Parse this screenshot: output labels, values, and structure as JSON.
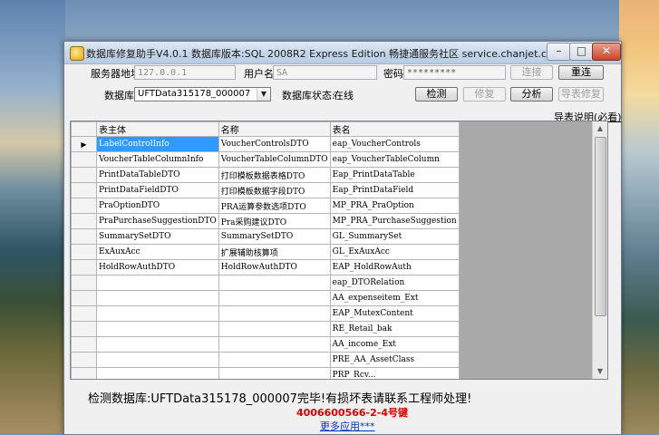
{
  "window": {
    "title": "数据库修复助手V4.0.1 数据库版本:SQL 2008R2 Express Edition  畅捷通服务社区 service.chanjet.com"
  },
  "form": {
    "server_label": "服务器地址",
    "server_value": "127.0.0.1",
    "user_label": "用户名",
    "user_value": "SA",
    "password_label": "密码",
    "password_value": "*********",
    "database_label": "数据库",
    "database_value": "UFTData315178_000007",
    "db_status_label": "数据库状态:",
    "db_status_value": "在线",
    "connect_btn": "连接",
    "reconnect_btn": "重连",
    "detect_btn": "检测",
    "repair_btn": "修复",
    "analyze_btn": "分析",
    "export_repair_btn": "导表修复",
    "export_notes_link": "导表说明(必看)"
  },
  "grid": {
    "columns": [
      "表主体",
      "名称",
      "表名"
    ],
    "rows": [
      [
        "LabelControlInfo",
        "VoucherControlsDTO",
        "eap_VoucherControls"
      ],
      [
        "VoucherTableColumnInfo",
        "VoucherTableColumnDTO",
        "eap_VoucherTableColumn"
      ],
      [
        "PrintDataTableDTO",
        "打印模板数据表格DTO",
        "Eap_PrintDataTable"
      ],
      [
        "PrintDataFieldDTO",
        "打印模板数据字段DTO",
        "Eap_PrintDataField"
      ],
      [
        "PraOptionDTO",
        "PRA运算参数选项DTO",
        "MP_PRA_PraOption"
      ],
      [
        "PraPurchaseSuggestionDTO",
        "Pra采购建议DTO",
        "MP_PRA_PurchaseSuggestion"
      ],
      [
        "SummarySetDTO",
        "SummarySetDTO",
        "GL_SummarySet"
      ],
      [
        "ExAuxAcc",
        "扩展辅助核算项",
        "GL_ExAuxAcc"
      ],
      [
        "HoldRowAuthDTO",
        "HoldRowAuthDTO",
        "EAP_HoldRowAuth"
      ],
      [
        "",
        "",
        "eap_DTORelation"
      ],
      [
        "",
        "",
        "AA_expenseitem_Ext"
      ],
      [
        "",
        "",
        "EAP_MutexContent"
      ],
      [
        "",
        "",
        "RE_Retail_bak"
      ],
      [
        "",
        "",
        "AA_income_Ext"
      ],
      [
        "",
        "",
        "PRE_AA_AssetClass"
      ],
      [
        "",
        "",
        "PRP_Rcv..."
      ]
    ]
  },
  "footer": {
    "message": "检测数据库:UFTData315178_000007完毕!有损坏表请联系工程师处理!",
    "phone": "4006600566-2-4号键",
    "more_apps": "更多应用***"
  },
  "icons": {
    "row_indicator": "current-row-arrow-icon",
    "dropdown": "chevron-down-icon"
  }
}
